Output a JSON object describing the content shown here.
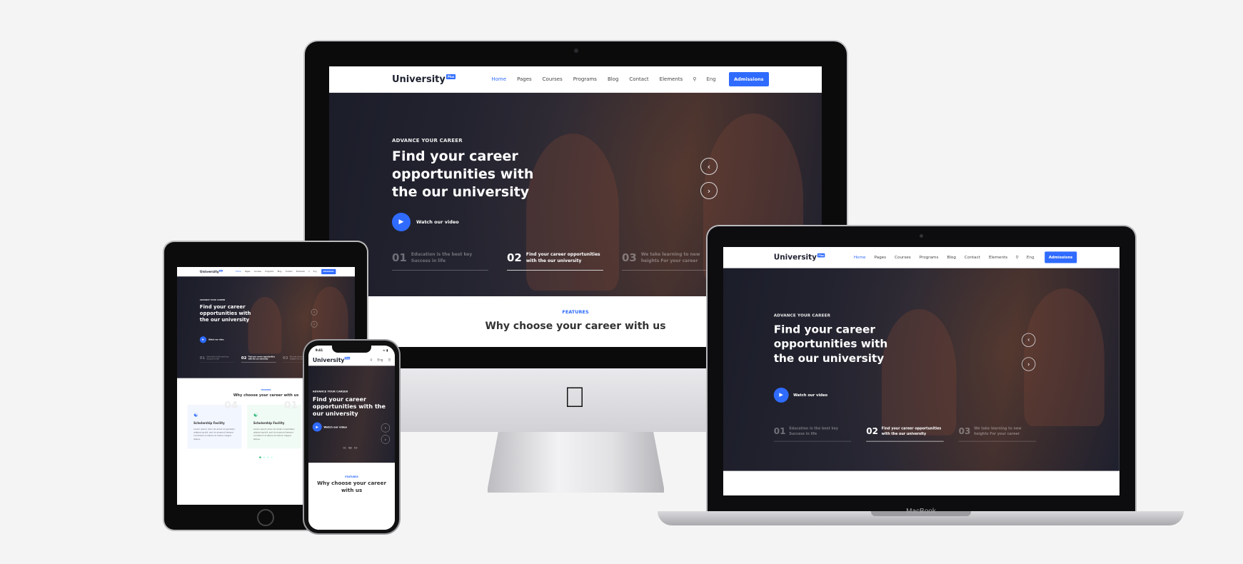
{
  "site": {
    "logo": "University",
    "logo_badge": "Plus",
    "menu": [
      "Home",
      "Pages",
      "Courses",
      "Programs",
      "Blog",
      "Contact",
      "Elements"
    ],
    "search_icon": "search-icon",
    "lang": "Eng",
    "admissions": "Admissions",
    "hero": {
      "eyebrow": "ADVANCE YOUR CAREER",
      "title": "Find your career opportunities with the our university",
      "watch": "Watch our video",
      "slides": [
        {
          "num": "01",
          "text": "Education is the best key Success in life"
        },
        {
          "num": "02",
          "text": "Find your career opportunities with the our university"
        },
        {
          "num": "03",
          "text": "We take learning to new heights For your career"
        }
      ]
    },
    "features": {
      "label": "FEATURES",
      "title": "Why choose your career with us",
      "cards": [
        {
          "num": "04",
          "title": "Scholarship Facility",
          "body": "Lorem ipsum dolor sit amet consectetur adipiscing elit, sed do eiusmod tempor incididunt ut labore et dolore magna aliqua."
        },
        {
          "num": "01",
          "title": "Scholarship Facility",
          "body": "Lorem ipsum dolor sit amet consectetur adipiscing elit, sed do eiusmod tempor incididunt ut labore et dolore magna aliqua."
        }
      ]
    }
  },
  "phone": {
    "time": "9:41",
    "slide_nums": [
      "01",
      "02",
      "03"
    ]
  },
  "macbook_label": "MacBook",
  "colors": {
    "accent": "#2f6bff",
    "green": "#2bb673",
    "background": "#f4f4f4"
  }
}
